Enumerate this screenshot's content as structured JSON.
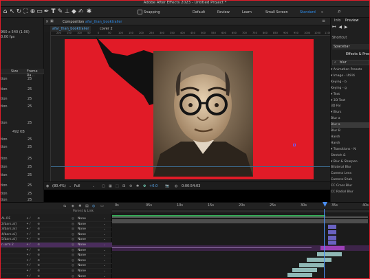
{
  "app": {
    "title": "Adobe After Effects 2023 - Untitled Project *"
  },
  "toolbar": {
    "snapping_label": "Snapping",
    "workspaces": [
      "Default",
      "Review",
      "Learn",
      "Small Screen",
      "Standard"
    ],
    "active_workspace": "Standard",
    "search_icon": "search-icon"
  },
  "project": {
    "info_line1": "960 x 540 (1.00)",
    "info_line2": "0.00 fps",
    "col_size": "Size",
    "col_framerate": "Frame Ra...",
    "rows": [
      {
        "type": "tion",
        "fps": "25"
      },
      {
        "type": "tion",
        "fps": "25"
      },
      {
        "type": "tion",
        "fps": "25"
      },
      {
        "type": "tion",
        "fps": "25"
      },
      {
        "type": "tion",
        "fps": "25"
      },
      {
        "type": "",
        "fps": "492 KB"
      },
      {
        "type": "tion",
        "fps": "25"
      },
      {
        "type": "tion",
        "fps": "25"
      },
      {
        "type": "tion",
        "fps": "25"
      },
      {
        "type": "tion",
        "fps": "25"
      },
      {
        "type": "tion",
        "fps": "25"
      },
      {
        "type": "tion",
        "fps": "25"
      },
      {
        "type": "tion",
        "fps": "25"
      },
      {
        "type": "tion",
        "fps": "25"
      }
    ]
  },
  "composition": {
    "panel_label": "Composition",
    "comp_name": "afar_than_booktrailer",
    "tabs": [
      "afar_than_booktrailer",
      "cover 2"
    ],
    "ruler_ticks": [
      "200",
      "150",
      "100",
      "50",
      "0",
      "50",
      "100",
      "150",
      "200",
      "250",
      "300",
      "350",
      "400",
      "450",
      "500",
      "550",
      "600",
      "650",
      "700",
      "750",
      "800",
      "850",
      "900",
      "950",
      "1000",
      "1050",
      "1100"
    ],
    "zoom": "(80.4%)",
    "resolution": "Full",
    "exposure": "+0.0",
    "timecode": "0:00:54:03"
  },
  "right": {
    "tabs": [
      "Info",
      "Preview"
    ],
    "shortcut_label": "Shortcut",
    "shortcut_value": "Spacebar",
    "effects_tab": "Effects & Pres",
    "search_value": "blur",
    "tree": [
      "▾ Animation Presets",
      "  ▾ Image - Utiliti",
      "      Keying - b",
      "      Keying - g",
      "  ▾ Text",
      "    ▾ 3D Text",
      "        3D Fal",
      "    ▾ Blurs",
      "        Blur a",
      "        Blur a",
      "        Blur B",
      "        Harsh",
      "        Harsh",
      "  ▾ Transitions - N",
      "      Stretch &",
      "▾ Blur & Sharpen",
      "    Bilateral Blur",
      "    Camera Lens",
      "    Camera-Shak",
      "    CC Cross Blur",
      "    CC Radial Blur"
    ],
    "selected_index": 9
  },
  "timeline": {
    "ruler": [
      "0s",
      "05s",
      "10s",
      "15s",
      "20s",
      "25s",
      "30s",
      "35s",
      "40s"
    ],
    "parent_header": "Parent & Link",
    "layers": [
      {
        "name": "AL.RE",
        "parent": "None"
      },
      {
        "name": "2/bars.ai]",
        "parent": "None"
      },
      {
        "name": "3/bars.ai]",
        "parent": "None"
      },
      {
        "name": "4/bars.ai]",
        "parent": "None"
      },
      {
        "name": "5/bars.ai]",
        "parent": "None"
      },
      {
        "name": "n arm 2",
        "parent": "None"
      },
      {
        "name": "",
        "parent": "None"
      },
      {
        "name": "",
        "parent": "None"
      },
      {
        "name": "",
        "parent": "None"
      },
      {
        "name": "",
        "parent": "None"
      },
      {
        "name": "",
        "parent": "None"
      },
      {
        "name": "",
        "parent": "None"
      }
    ],
    "highlighted_layer": 5
  }
}
